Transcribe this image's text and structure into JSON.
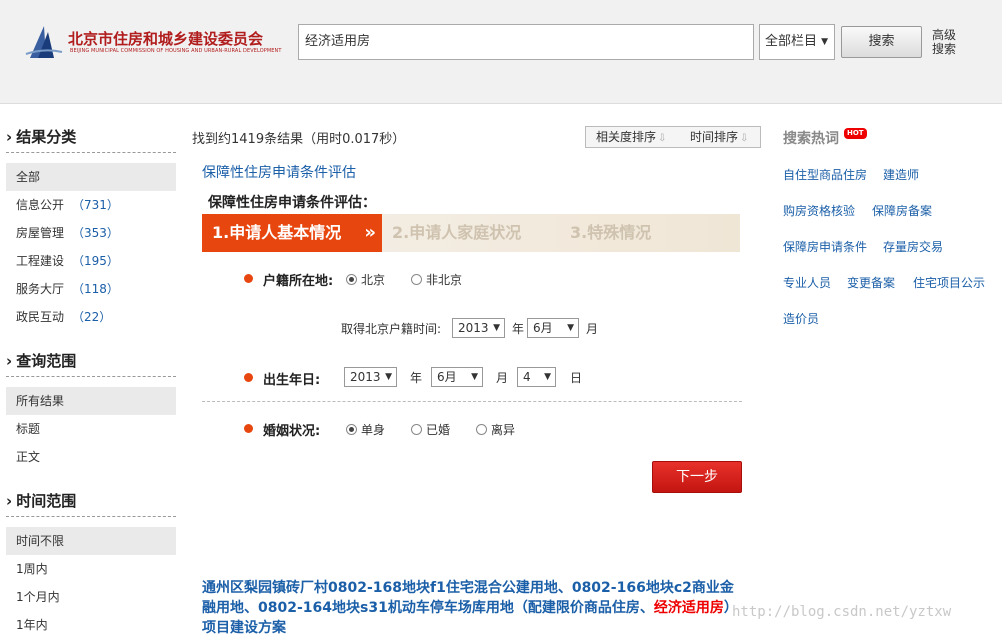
{
  "header": {
    "logo_text": "北京市住房和城乡建设委员会",
    "logo_sub": "BEIJING MUNICIPAL COMMISSION OF HOUSING AND URBAN-RURAL DEVELOPMENT",
    "search_value": "经济适用房",
    "scope_value": "全部栏目",
    "search_label": "搜索",
    "advanced_label": "高级搜索"
  },
  "sidebar": {
    "category_title": "结果分类",
    "categories": [
      {
        "label": "全部",
        "count": ""
      },
      {
        "label": "信息公开",
        "count": "（731）"
      },
      {
        "label": "房屋管理",
        "count": "（353）"
      },
      {
        "label": "工程建设",
        "count": "（195）"
      },
      {
        "label": "服务大厅",
        "count": "（118）"
      },
      {
        "label": "政民互动",
        "count": "（22）"
      }
    ],
    "scope_title": "查询范围",
    "scopes": [
      "所有结果",
      "标题",
      "正文"
    ],
    "time_title": "时间范围",
    "times": [
      "时间不限",
      "1周内",
      "1个月内",
      "1年内"
    ]
  },
  "main": {
    "result_count": "找到约1419条结果（用时0.017秒）",
    "sort_relevance": "相关度排序",
    "sort_time": "时间排序",
    "item_title": "保障性住房申请条件评估",
    "eval_heading": "保障性住房申请条件评估：",
    "steps": [
      "1.申请人基本情况",
      "2.申请人家庭状况",
      "3.特殊情况"
    ],
    "step_chevron": "»",
    "residence_label": "户籍所在地:",
    "residence_options": [
      "北京",
      "非北京"
    ],
    "residence_time_label": "取得北京户籍时间:",
    "residence_year": "2013",
    "residence_month": "6月",
    "year_unit": "年",
    "month_unit": "月",
    "day_unit": "日",
    "birth_label": "出生年日:",
    "birth_year": "2013",
    "birth_month": "6月",
    "birth_day": "4",
    "marriage_label": "婚姻状况:",
    "marriage_options": [
      "单身",
      "已婚",
      "离异"
    ],
    "next_label": "下一步",
    "result2_text_a": "通州区梨园镇砖厂村0802-168地块f1住宅混合公建用地、0802-166地块c2商业金融用地、0802-164地块s31机动车停车场库用地（配建限价商品住房、",
    "result2_highlight": "经济适用房",
    "result2_text_b": "）项目建设方案"
  },
  "hot": {
    "title": "搜索热词",
    "badge": "HOT",
    "links": [
      "自住型商品住房",
      "建造师",
      "购房资格核验",
      "保障房备案",
      "保障房申请条件",
      "存量房交易",
      "专业人员",
      "变更备案",
      "住宅项目公示",
      "造价员"
    ]
  },
  "watermark": "http://blog.csdn.net/yztxw"
}
